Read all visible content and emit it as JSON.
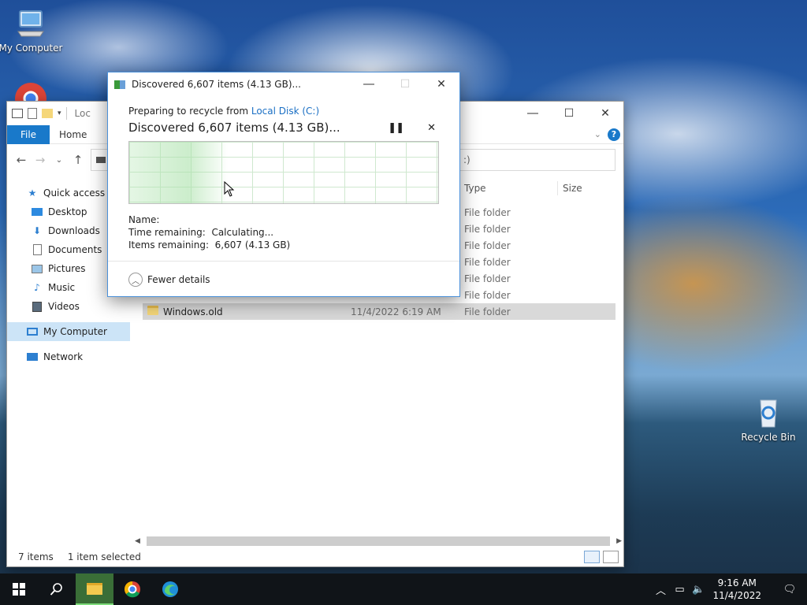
{
  "desktop": {
    "icons": [
      {
        "label": "My Computer"
      },
      {
        "label": "Recycle Bin"
      }
    ]
  },
  "explorer": {
    "title_partial": "Loc",
    "ribbon": {
      "file_tab": "File",
      "home_tab": "Home"
    },
    "address_partial": "",
    "search_partial": ":)",
    "columns": {
      "type": "Type",
      "size": "Size"
    },
    "nav": {
      "quick_access": "Quick access",
      "desktop": "Desktop",
      "downloads": "Downloads",
      "documents": "Documents",
      "pictures": "Pictures",
      "music": "Music",
      "videos": "Videos",
      "my_computer": "My Computer",
      "network": "Network"
    },
    "files": [
      {
        "name": "",
        "date": "",
        "type": "File folder"
      },
      {
        "name": "",
        "date": "",
        "type": "File folder"
      },
      {
        "name": "",
        "date": "",
        "type": "File folder"
      },
      {
        "name": "",
        "date": "",
        "type": "File folder"
      },
      {
        "name": "",
        "date": "",
        "type": "File folder"
      },
      {
        "name": "",
        "date": "",
        "type": "File folder"
      },
      {
        "name": "Windows.old",
        "date": "11/4/2022 6:19 AM",
        "type": "File folder",
        "selected": true
      }
    ],
    "status": {
      "items": "7 items",
      "selected": "1 item selected"
    }
  },
  "dialog": {
    "title": "Discovered 6,607 items (4.13 GB)...",
    "preparing_prefix": "Preparing to recycle from ",
    "source_link": "Local Disk (C:)",
    "heading": "Discovered 6,607 items (4.13 GB)...",
    "pause_icon": "pause-icon",
    "cancel_icon": "close-icon",
    "name_label": "Name:",
    "time_remaining": "Time remaining:  Calculating...",
    "items_remaining": "Items remaining:  6,607 (4.13 GB)",
    "fewer_details": "Fewer details"
  },
  "taskbar": {
    "time": "9:16 AM",
    "date": "11/4/2022"
  },
  "colors": {
    "accent": "#1979ca",
    "link": "#1a6fc4",
    "graph_grid": "#cfe8cf"
  }
}
